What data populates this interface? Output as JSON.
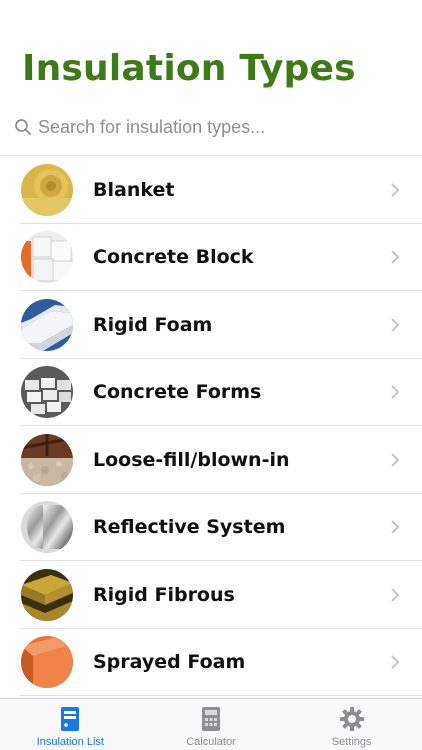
{
  "header": {
    "title": "Insulation Types"
  },
  "search": {
    "placeholder": "Search for insulation types...",
    "icon": "search-icon"
  },
  "items": [
    {
      "label": "Blanket",
      "thumbnail": "blanket-thumbnail"
    },
    {
      "label": "Concrete Block",
      "thumbnail": "concrete-block-thumbnail"
    },
    {
      "label": "Rigid Foam",
      "thumbnail": "rigid-foam-thumbnail"
    },
    {
      "label": "Concrete Forms",
      "thumbnail": "concrete-forms-thumbnail"
    },
    {
      "label": "Loose-fill/blown-in",
      "thumbnail": "loose-fill-thumbnail"
    },
    {
      "label": "Reflective System",
      "thumbnail": "reflective-system-thumbnail"
    },
    {
      "label": "Rigid Fibrous",
      "thumbnail": "rigid-fibrous-thumbnail"
    },
    {
      "label": "Sprayed Foam",
      "thumbnail": "sprayed-foam-thumbnail"
    }
  ],
  "tabbar": {
    "tabs": [
      {
        "label": "Insulation List",
        "icon": "list-icon",
        "active": true
      },
      {
        "label": "Calculator",
        "icon": "calculator-icon",
        "active": false
      },
      {
        "label": "Settings",
        "icon": "gear-icon",
        "active": false
      }
    ]
  },
  "colors": {
    "title": "#3f7a18",
    "accent": "#1a78e6",
    "inactive": "#8e8e93"
  }
}
